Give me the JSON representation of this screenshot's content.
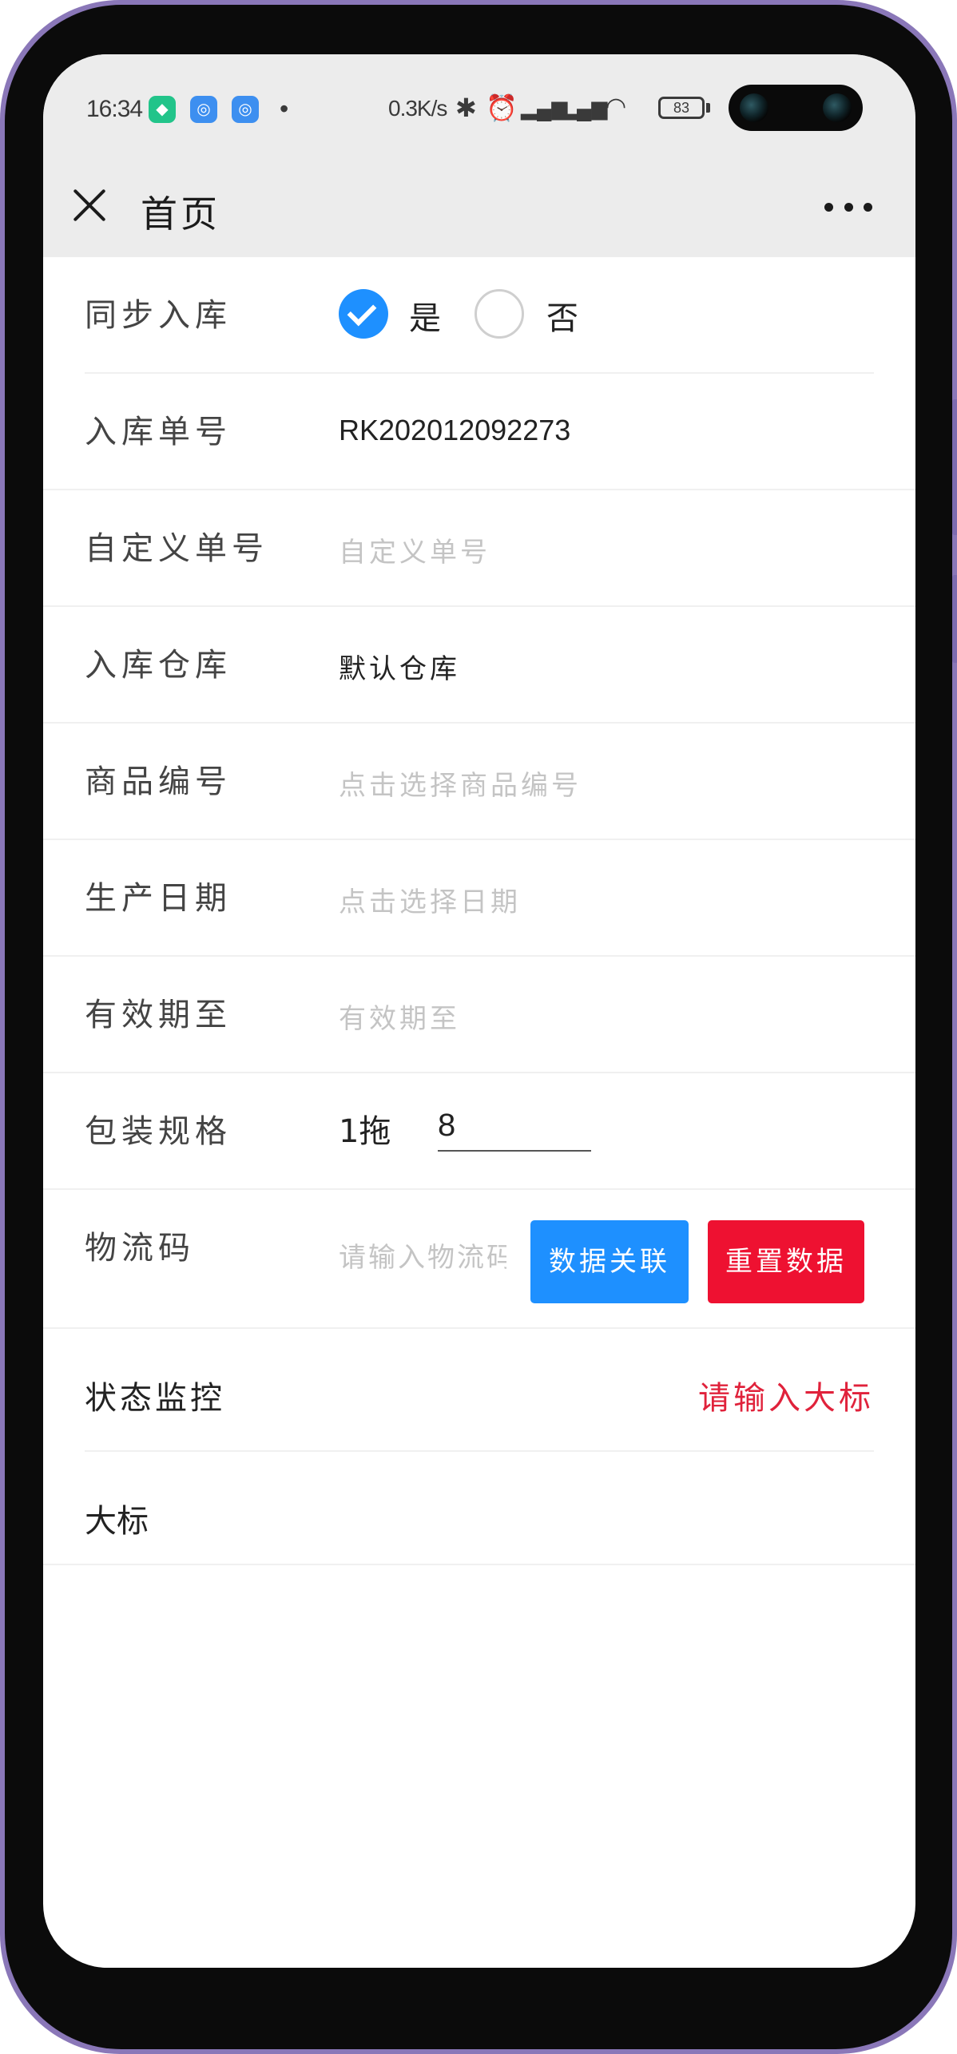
{
  "status_bar": {
    "time": "16:34",
    "net_speed": "0.3K/s",
    "battery": "83",
    "icons": [
      "shield-app-icon",
      "swirl-app-icon",
      "swirl-app-icon",
      "bluetooth-icon",
      "alarm-icon",
      "hd-signal-icon",
      "signal-icon",
      "wifi-icon",
      "battery-icon"
    ]
  },
  "nav": {
    "title": "首页"
  },
  "form": {
    "sync": {
      "label": "同步入库",
      "yes": "是",
      "no": "否",
      "selected": "是"
    },
    "order_no": {
      "label": "入库单号",
      "value": "RK202012092273"
    },
    "custom_no": {
      "label": "自定义单号",
      "placeholder": "自定义单号"
    },
    "warehouse": {
      "label": "入库仓库",
      "value": "默认仓库"
    },
    "product_no": {
      "label": "商品编号",
      "placeholder": "点击选择商品编号"
    },
    "production_date": {
      "label": "生产日期",
      "placeholder": "点击选择日期"
    },
    "expiry": {
      "label": "有效期至",
      "placeholder": "有效期至"
    },
    "packaging": {
      "label": "包装规格",
      "prefix": "1拖",
      "value": "8"
    },
    "logistics": {
      "label": "物流码",
      "placeholder": "请输入物流码",
      "link_button": "数据关联",
      "reset_button": "重置数据"
    },
    "monitor": {
      "label": "状态监控",
      "value": "请输入大标"
    },
    "big_label": {
      "label": "大标"
    }
  },
  "colors": {
    "primary": "#1e90ff",
    "danger": "#ee1131",
    "status_text": "#e0223b",
    "nav_bg": "#ececec"
  }
}
